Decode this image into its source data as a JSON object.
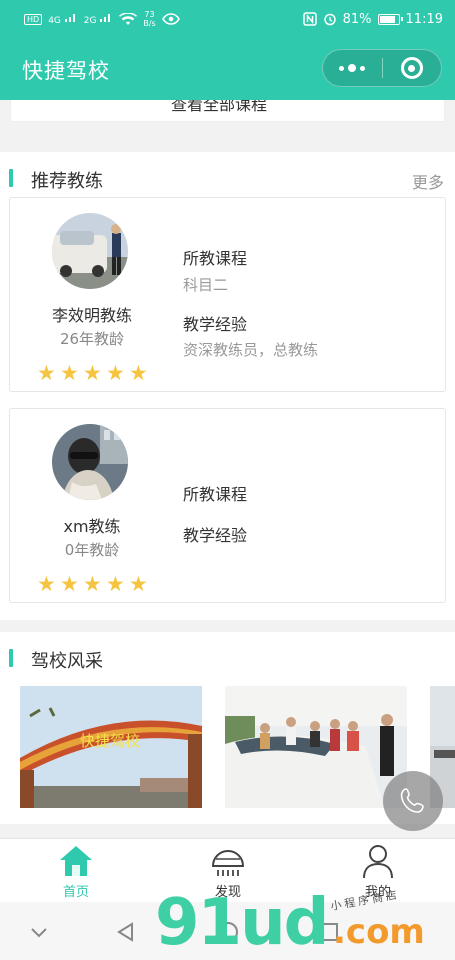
{
  "status_bar": {
    "hd": "HD",
    "net1": "4G",
    "net2": "2G",
    "speed_value": "73",
    "speed_unit": "B/s",
    "battery": "81%",
    "time": "11:19"
  },
  "header": {
    "title": "快捷驾校"
  },
  "top_remnant": {
    "text": "查看全部课程"
  },
  "coaches_section": {
    "title": "推荐教练",
    "more": "更多",
    "coaches": [
      {
        "name": "李效明教练",
        "years": "26年教龄",
        "course_label": "所教课程",
        "course_value": "科目二",
        "exp_label": "教学经验",
        "exp_value": "资深教练员，总教练",
        "rating": 5
      },
      {
        "name": "xm教练",
        "years": "0年教龄",
        "course_label": "所教课程",
        "course_value": "",
        "exp_label": "教学经验",
        "exp_value": "",
        "rating": 5
      }
    ]
  },
  "gallery_section": {
    "title": "驾校风采",
    "arch_sign": "快捷驾校"
  },
  "tabs": [
    {
      "label": "首页",
      "icon": "home-icon",
      "active": true
    },
    {
      "label": "发现",
      "icon": "discover-icon",
      "active": false
    },
    {
      "label": "我的",
      "icon": "user-icon",
      "active": false
    }
  ],
  "watermark": {
    "main": "91ud",
    "suffix": ".com",
    "tagline": "小程序商店"
  },
  "colors": {
    "accent": "#2fc9ad",
    "star": "#f5c542",
    "muted": "#999999"
  }
}
